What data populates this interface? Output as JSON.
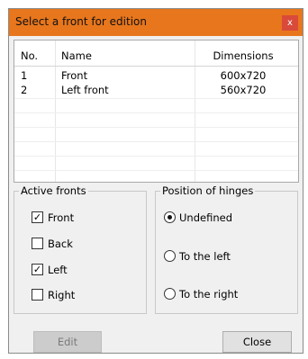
{
  "dialog": {
    "title": "Select a front for edition",
    "close_glyph": "x"
  },
  "list": {
    "columns": [
      "No.",
      "Name",
      "Dimensions"
    ],
    "rows": [
      {
        "no": "1",
        "name": "Front",
        "dimensions": "600x720"
      },
      {
        "no": "2",
        "name": "Left front",
        "dimensions": "560x720"
      }
    ]
  },
  "active_fronts": {
    "title": "Active fronts",
    "items": [
      {
        "label": "Front",
        "checked": true
      },
      {
        "label": "Back",
        "checked": false
      },
      {
        "label": "Left",
        "checked": true
      },
      {
        "label": "Right",
        "checked": false
      }
    ]
  },
  "hinges": {
    "title": "Position of hinges",
    "options": [
      {
        "label": "Undefined",
        "selected": true
      },
      {
        "label": "To the left",
        "selected": false
      },
      {
        "label": "To the right",
        "selected": false
      }
    ]
  },
  "buttons": {
    "edit": "Edit",
    "close": "Close"
  },
  "checkmark_glyph": "✓",
  "colors": {
    "titlebar": "#e8761c",
    "close_button": "#d94a3a"
  }
}
